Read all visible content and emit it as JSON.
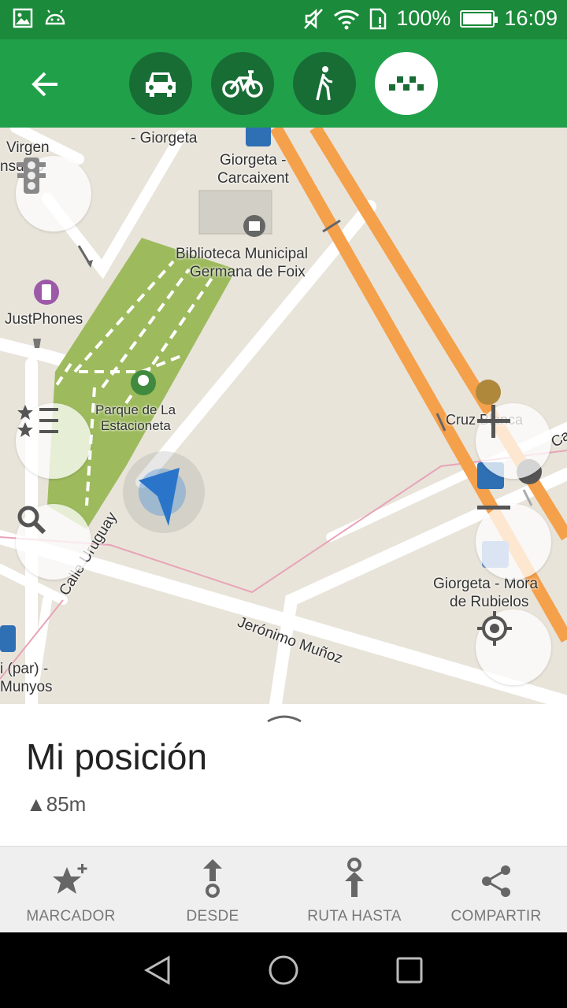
{
  "status_bar": {
    "battery": "100%",
    "time": "16:09"
  },
  "toolbar": {
    "modes": [
      {
        "name": "car",
        "active": false
      },
      {
        "name": "bicycle",
        "active": false
      },
      {
        "name": "walk",
        "active": false
      },
      {
        "name": "taxi",
        "active": true
      }
    ],
    "colors": {
      "bar": "#21a04a",
      "status": "#1b8a3a",
      "mode_bg": "#186d35"
    }
  },
  "map": {
    "labels": {
      "virgen": "Virgen",
      "consuelo": "nsuelo",
      "giorgeta_top": "- Giorgeta",
      "giorgeta_carcaixent_1": "Giorgeta -",
      "giorgeta_carcaixent_2": "Carcaixent",
      "biblioteca_1": "Biblioteca Municipal",
      "biblioteca_2": "Germana de Foix",
      "justphones": "JustPhones",
      "parque_1": "Parque de La",
      "parque_2": "Estacioneta",
      "cruz_blanca": "Cruz Blanca",
      "ca": "Ca",
      "mora_1": "Giorgeta - Mora",
      "mora_2": "de Rubielos",
      "calle_uruguay": "Calle Uruguay",
      "jeronimo": "Jerónimo Muñoz",
      "par_1": "i (par) -",
      "par_2": "Munyos"
    }
  },
  "sheet": {
    "title": "Mi posición",
    "elevation": "▲85m"
  },
  "actions": [
    {
      "label": "MARCADOR",
      "icon": "star-plus-icon"
    },
    {
      "label": "DESDE",
      "icon": "route-from-icon"
    },
    {
      "label": "RUTA HASTA",
      "icon": "route-to-icon"
    },
    {
      "label": "COMPARTIR",
      "icon": "share-icon"
    }
  ]
}
